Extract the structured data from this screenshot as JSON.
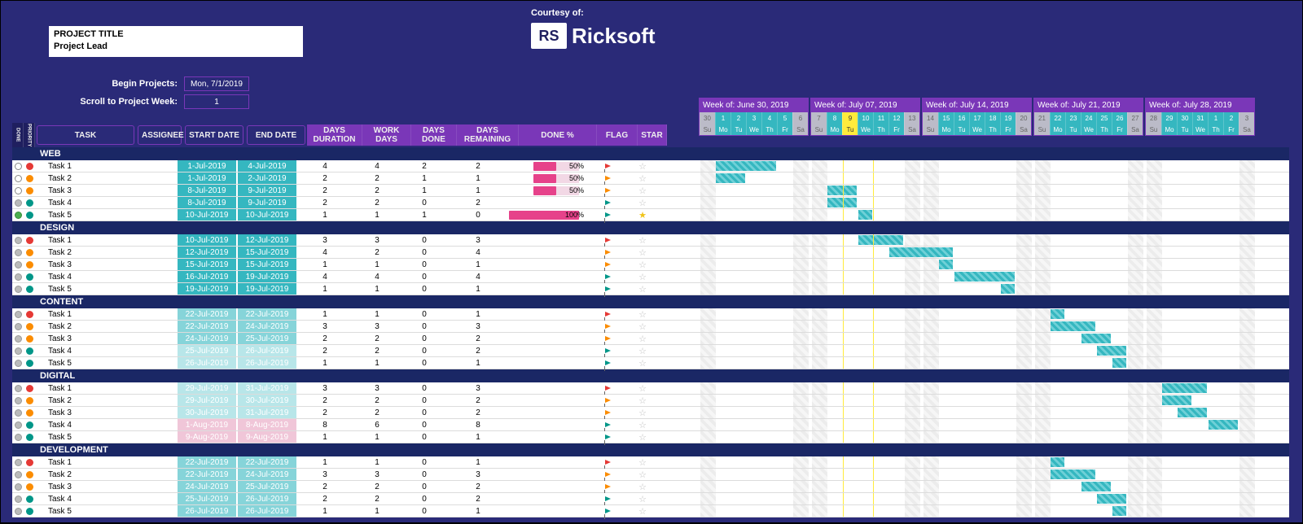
{
  "header": {
    "project_title_label": "PROJECT TITLE",
    "project_lead_label": "Project Lead",
    "courtesy": "Courtesy of:",
    "logo_text": "Ricksoft",
    "logo_badge": "RS",
    "begin_label": "Begin Projects:",
    "begin_value": "Mon, 7/1/2019",
    "scroll_label": "Scroll to Project Week:",
    "scroll_value": "1"
  },
  "columns": {
    "done": "DONE",
    "priority": "PRIORITY",
    "task": "TASK",
    "assignee": "ASSIGNEE",
    "start": "START DATE",
    "end": "END DATE",
    "duration": "DAYS DURATION",
    "work": "WORK DAYS",
    "days_done": "DAYS DONE",
    "days_remaining": "DAYS REMAINING",
    "done_pct": "DONE %",
    "flag": "FLAG",
    "star": "STAR"
  },
  "weeks": [
    {
      "label": "Week of: June 30, 2019",
      "days": [
        {
          "n": "30",
          "d": "Su",
          "t": "g"
        },
        {
          "n": "1",
          "d": "Mo",
          "t": "t"
        },
        {
          "n": "2",
          "d": "Tu",
          "t": "t"
        },
        {
          "n": "3",
          "d": "We",
          "t": "t"
        },
        {
          "n": "4",
          "d": "Th",
          "t": "t"
        },
        {
          "n": "5",
          "d": "Fr",
          "t": "t"
        },
        {
          "n": "6",
          "d": "Sa",
          "t": "g"
        }
      ]
    },
    {
      "label": "Week of: July 07, 2019",
      "days": [
        {
          "n": "7",
          "d": "Su",
          "t": "g"
        },
        {
          "n": "8",
          "d": "Mo",
          "t": "t"
        },
        {
          "n": "9",
          "d": "Tu",
          "t": "h"
        },
        {
          "n": "10",
          "d": "We",
          "t": "t"
        },
        {
          "n": "11",
          "d": "Th",
          "t": "t"
        },
        {
          "n": "12",
          "d": "Fr",
          "t": "t"
        },
        {
          "n": "13",
          "d": "Sa",
          "t": "g"
        }
      ]
    },
    {
      "label": "Week of: July 14, 2019",
      "days": [
        {
          "n": "14",
          "d": "Su",
          "t": "g"
        },
        {
          "n": "15",
          "d": "Mo",
          "t": "t"
        },
        {
          "n": "16",
          "d": "Tu",
          "t": "t"
        },
        {
          "n": "17",
          "d": "We",
          "t": "t"
        },
        {
          "n": "18",
          "d": "Th",
          "t": "t"
        },
        {
          "n": "19",
          "d": "Fr",
          "t": "t"
        },
        {
          "n": "20",
          "d": "Sa",
          "t": "g"
        }
      ]
    },
    {
      "label": "Week of: July 21, 2019",
      "days": [
        {
          "n": "21",
          "d": "Su",
          "t": "g"
        },
        {
          "n": "22",
          "d": "Mo",
          "t": "t"
        },
        {
          "n": "23",
          "d": "Tu",
          "t": "t"
        },
        {
          "n": "24",
          "d": "We",
          "t": "t"
        },
        {
          "n": "25",
          "d": "Th",
          "t": "t"
        },
        {
          "n": "26",
          "d": "Fr",
          "t": "t"
        },
        {
          "n": "27",
          "d": "Sa",
          "t": "g"
        }
      ]
    },
    {
      "label": "Week of: July 28, 2019",
      "days": [
        {
          "n": "28",
          "d": "Su",
          "t": "g"
        },
        {
          "n": "29",
          "d": "Mo",
          "t": "t"
        },
        {
          "n": "30",
          "d": "Tu",
          "t": "t"
        },
        {
          "n": "31",
          "d": "We",
          "t": "t"
        },
        {
          "n": "1",
          "d": "Th",
          "t": "t"
        },
        {
          "n": "2",
          "d": "Fr",
          "t": "t"
        },
        {
          "n": "3",
          "d": "Sa",
          "t": "g"
        }
      ]
    }
  ],
  "weekend_cols": [
    0,
    6,
    7,
    13,
    14,
    20,
    21,
    27,
    28,
    34
  ],
  "today_col_start": 9,
  "today_col_end": 10,
  "groups": [
    {
      "name": "WEB",
      "rows": [
        {
          "done": "open",
          "pri": "red",
          "task": "Task 1",
          "start": "1-Jul-2019",
          "end": "4-Jul-2019",
          "dur": 4,
          "wrk": 4,
          "dd": 2,
          "dr": 2,
          "pct": 50,
          "flag": "red",
          "star": "open",
          "bar": [
            1,
            4
          ],
          "fade": 0
        },
        {
          "done": "open",
          "pri": "orange",
          "task": "Task 2",
          "start": "1-Jul-2019",
          "end": "2-Jul-2019",
          "dur": 2,
          "wrk": 2,
          "dd": 1,
          "dr": 1,
          "pct": 50,
          "flag": "orange",
          "star": "open",
          "bar": [
            1,
            2
          ],
          "fade": 0
        },
        {
          "done": "open",
          "pri": "orange",
          "task": "Task 3",
          "start": "8-Jul-2019",
          "end": "9-Jul-2019",
          "dur": 2,
          "wrk": 2,
          "dd": 1,
          "dr": 1,
          "pct": 50,
          "flag": "orange",
          "star": "open",
          "bar": [
            8,
            9
          ],
          "fade": 0
        },
        {
          "done": "grey",
          "pri": "teal",
          "task": "Task 4",
          "start": "8-Jul-2019",
          "end": "9-Jul-2019",
          "dur": 2,
          "wrk": 2,
          "dd": 0,
          "dr": 2,
          "pct": 0,
          "flag": "teal",
          "star": "open",
          "bar": [
            8,
            9
          ],
          "fade": 0
        },
        {
          "done": "check",
          "pri": "teal",
          "task": "Task 5",
          "start": "10-Jul-2019",
          "end": "10-Jul-2019",
          "dur": 1,
          "wrk": 1,
          "dd": 1,
          "dr": 0,
          "pct": 100,
          "flag": "teal",
          "star": "gold",
          "bar": [
            10,
            10
          ],
          "fade": 0
        }
      ]
    },
    {
      "name": "DESIGN",
      "rows": [
        {
          "done": "grey",
          "pri": "red",
          "task": "Task 1",
          "start": "10-Jul-2019",
          "end": "12-Jul-2019",
          "dur": 3,
          "wrk": 3,
          "dd": 0,
          "dr": 3,
          "pct": 0,
          "flag": "red",
          "star": "open",
          "bar": [
            10,
            12
          ],
          "fade": 0
        },
        {
          "done": "grey",
          "pri": "orange",
          "task": "Task 2",
          "start": "12-Jul-2019",
          "end": "15-Jul-2019",
          "dur": 4,
          "wrk": 2,
          "dd": 0,
          "dr": 4,
          "pct": 0,
          "flag": "orange",
          "star": "open",
          "bar": [
            12,
            15
          ],
          "fade": 0
        },
        {
          "done": "grey",
          "pri": "orange",
          "task": "Task 3",
          "start": "15-Jul-2019",
          "end": "15-Jul-2019",
          "dur": 1,
          "wrk": 1,
          "dd": 0,
          "dr": 1,
          "pct": 0,
          "flag": "orange",
          "star": "open",
          "bar": [
            15,
            15
          ],
          "fade": 0
        },
        {
          "done": "grey",
          "pri": "teal",
          "task": "Task 4",
          "start": "16-Jul-2019",
          "end": "19-Jul-2019",
          "dur": 4,
          "wrk": 4,
          "dd": 0,
          "dr": 4,
          "pct": 0,
          "flag": "teal",
          "star": "open",
          "bar": [
            16,
            19
          ],
          "fade": 0
        },
        {
          "done": "grey",
          "pri": "teal",
          "task": "Task 5",
          "start": "19-Jul-2019",
          "end": "19-Jul-2019",
          "dur": 1,
          "wrk": 1,
          "dd": 0,
          "dr": 1,
          "pct": 0,
          "flag": "teal",
          "star": "open",
          "bar": [
            19,
            19
          ],
          "fade": 0
        }
      ]
    },
    {
      "name": "CONTENT",
      "rows": [
        {
          "done": "grey",
          "pri": "red",
          "task": "Task 1",
          "start": "22-Jul-2019",
          "end": "22-Jul-2019",
          "dur": 1,
          "wrk": 1,
          "dd": 0,
          "dr": 1,
          "pct": 0,
          "flag": "red",
          "star": "open",
          "bar": [
            22,
            22
          ],
          "fade": 1
        },
        {
          "done": "grey",
          "pri": "orange",
          "task": "Task 2",
          "start": "22-Jul-2019",
          "end": "24-Jul-2019",
          "dur": 3,
          "wrk": 3,
          "dd": 0,
          "dr": 3,
          "pct": 0,
          "flag": "orange",
          "star": "open",
          "bar": [
            22,
            24
          ],
          "fade": 1
        },
        {
          "done": "grey",
          "pri": "orange",
          "task": "Task 3",
          "start": "24-Jul-2019",
          "end": "25-Jul-2019",
          "dur": 2,
          "wrk": 2,
          "dd": 0,
          "dr": 2,
          "pct": 0,
          "flag": "orange",
          "star": "open",
          "bar": [
            24,
            25
          ],
          "fade": 1
        },
        {
          "done": "grey",
          "pri": "teal",
          "task": "Task 4",
          "start": "25-Jul-2019",
          "end": "26-Jul-2019",
          "dur": 2,
          "wrk": 2,
          "dd": 0,
          "dr": 2,
          "pct": 0,
          "flag": "teal",
          "star": "open",
          "bar": [
            25,
            26
          ],
          "fade": 2
        },
        {
          "done": "grey",
          "pri": "teal",
          "task": "Task 5",
          "start": "26-Jul-2019",
          "end": "26-Jul-2019",
          "dur": 1,
          "wrk": 1,
          "dd": 0,
          "dr": 1,
          "pct": 0,
          "flag": "teal",
          "star": "open",
          "bar": [
            26,
            26
          ],
          "fade": 2
        }
      ]
    },
    {
      "name": "DIGITAL",
      "rows": [
        {
          "done": "grey",
          "pri": "red",
          "task": "Task 1",
          "start": "29-Jul-2019",
          "end": "31-Jul-2019",
          "dur": 3,
          "wrk": 3,
          "dd": 0,
          "dr": 3,
          "pct": 0,
          "flag": "red",
          "star": "open",
          "bar": [
            29,
            31
          ],
          "fade": 2
        },
        {
          "done": "grey",
          "pri": "orange",
          "task": "Task 2",
          "start": "29-Jul-2019",
          "end": "30-Jul-2019",
          "dur": 2,
          "wrk": 2,
          "dd": 0,
          "dr": 2,
          "pct": 0,
          "flag": "orange",
          "star": "open",
          "bar": [
            29,
            30
          ],
          "fade": 2
        },
        {
          "done": "grey",
          "pri": "orange",
          "task": "Task 3",
          "start": "30-Jul-2019",
          "end": "31-Jul-2019",
          "dur": 2,
          "wrk": 2,
          "dd": 0,
          "dr": 2,
          "pct": 0,
          "flag": "orange",
          "star": "open",
          "bar": [
            30,
            31
          ],
          "fade": 2
        },
        {
          "done": "grey",
          "pri": "teal",
          "task": "Task 4",
          "start": "1-Aug-2019",
          "end": "8-Aug-2019",
          "dur": 8,
          "wrk": 6,
          "dd": 0,
          "dr": 8,
          "pct": 0,
          "flag": "teal",
          "star": "open",
          "bar": [
            32,
            33
          ],
          "fade": 3
        },
        {
          "done": "grey",
          "pri": "teal",
          "task": "Task 5",
          "start": "9-Aug-2019",
          "end": "9-Aug-2019",
          "dur": 1,
          "wrk": 1,
          "dd": 0,
          "dr": 1,
          "pct": 0,
          "flag": "teal",
          "star": "open",
          "bar": [
            -1,
            -1
          ],
          "fade": 3
        }
      ]
    },
    {
      "name": "DEVELOPMENT",
      "rows": [
        {
          "done": "grey",
          "pri": "red",
          "task": "Task 1",
          "start": "22-Jul-2019",
          "end": "22-Jul-2019",
          "dur": 1,
          "wrk": 1,
          "dd": 0,
          "dr": 1,
          "pct": 0,
          "flag": "red",
          "star": "open",
          "bar": [
            22,
            22
          ],
          "fade": 1
        },
        {
          "done": "grey",
          "pri": "orange",
          "task": "Task 2",
          "start": "22-Jul-2019",
          "end": "24-Jul-2019",
          "dur": 3,
          "wrk": 3,
          "dd": 0,
          "dr": 3,
          "pct": 0,
          "flag": "orange",
          "star": "open",
          "bar": [
            22,
            24
          ],
          "fade": 1
        },
        {
          "done": "grey",
          "pri": "orange",
          "task": "Task 3",
          "start": "24-Jul-2019",
          "end": "25-Jul-2019",
          "dur": 2,
          "wrk": 2,
          "dd": 0,
          "dr": 2,
          "pct": 0,
          "flag": "orange",
          "star": "open",
          "bar": [
            24,
            25
          ],
          "fade": 1
        },
        {
          "done": "grey",
          "pri": "teal",
          "task": "Task 4",
          "start": "25-Jul-2019",
          "end": "26-Jul-2019",
          "dur": 2,
          "wrk": 2,
          "dd": 0,
          "dr": 2,
          "pct": 0,
          "flag": "teal",
          "star": "open",
          "bar": [
            25,
            26
          ],
          "fade": 1
        },
        {
          "done": "grey",
          "pri": "teal",
          "task": "Task 5",
          "start": "26-Jul-2019",
          "end": "26-Jul-2019",
          "dur": 1,
          "wrk": 1,
          "dd": 0,
          "dr": 1,
          "pct": 0,
          "flag": "teal",
          "star": "open",
          "bar": [
            26,
            26
          ],
          "fade": 1
        }
      ]
    }
  ],
  "chart_data": {
    "type": "gantt",
    "start_date": "2019-06-30",
    "end_date": "2019-08-03",
    "highlight_date": "2019-07-09",
    "groups": [
      "WEB",
      "DESIGN",
      "CONTENT",
      "DIGITAL",
      "DEVELOPMENT"
    ],
    "tasks": [
      {
        "group": "WEB",
        "name": "Task 1",
        "start": "2019-07-01",
        "end": "2019-07-04",
        "pct_done": 50
      },
      {
        "group": "WEB",
        "name": "Task 2",
        "start": "2019-07-01",
        "end": "2019-07-02",
        "pct_done": 50
      },
      {
        "group": "WEB",
        "name": "Task 3",
        "start": "2019-07-08",
        "end": "2019-07-09",
        "pct_done": 50
      },
      {
        "group": "WEB",
        "name": "Task 4",
        "start": "2019-07-08",
        "end": "2019-07-09",
        "pct_done": 0
      },
      {
        "group": "WEB",
        "name": "Task 5",
        "start": "2019-07-10",
        "end": "2019-07-10",
        "pct_done": 100
      },
      {
        "group": "DESIGN",
        "name": "Task 1",
        "start": "2019-07-10",
        "end": "2019-07-12",
        "pct_done": 0
      },
      {
        "group": "DESIGN",
        "name": "Task 2",
        "start": "2019-07-12",
        "end": "2019-07-15",
        "pct_done": 0
      },
      {
        "group": "DESIGN",
        "name": "Task 3",
        "start": "2019-07-15",
        "end": "2019-07-15",
        "pct_done": 0
      },
      {
        "group": "DESIGN",
        "name": "Task 4",
        "start": "2019-07-16",
        "end": "2019-07-19",
        "pct_done": 0
      },
      {
        "group": "DESIGN",
        "name": "Task 5",
        "start": "2019-07-19",
        "end": "2019-07-19",
        "pct_done": 0
      },
      {
        "group": "CONTENT",
        "name": "Task 1",
        "start": "2019-07-22",
        "end": "2019-07-22",
        "pct_done": 0
      },
      {
        "group": "CONTENT",
        "name": "Task 2",
        "start": "2019-07-22",
        "end": "2019-07-24",
        "pct_done": 0
      },
      {
        "group": "CONTENT",
        "name": "Task 3",
        "start": "2019-07-24",
        "end": "2019-07-25",
        "pct_done": 0
      },
      {
        "group": "CONTENT",
        "name": "Task 4",
        "start": "2019-07-25",
        "end": "2019-07-26",
        "pct_done": 0
      },
      {
        "group": "CONTENT",
        "name": "Task 5",
        "start": "2019-07-26",
        "end": "2019-07-26",
        "pct_done": 0
      },
      {
        "group": "DIGITAL",
        "name": "Task 1",
        "start": "2019-07-29",
        "end": "2019-07-31",
        "pct_done": 0
      },
      {
        "group": "DIGITAL",
        "name": "Task 2",
        "start": "2019-07-29",
        "end": "2019-07-30",
        "pct_done": 0
      },
      {
        "group": "DIGITAL",
        "name": "Task 3",
        "start": "2019-07-30",
        "end": "2019-07-31",
        "pct_done": 0
      },
      {
        "group": "DIGITAL",
        "name": "Task 4",
        "start": "2019-08-01",
        "end": "2019-08-08",
        "pct_done": 0
      },
      {
        "group": "DIGITAL",
        "name": "Task 5",
        "start": "2019-08-09",
        "end": "2019-08-09",
        "pct_done": 0
      },
      {
        "group": "DEVELOPMENT",
        "name": "Task 1",
        "start": "2019-07-22",
        "end": "2019-07-22",
        "pct_done": 0
      },
      {
        "group": "DEVELOPMENT",
        "name": "Task 2",
        "start": "2019-07-22",
        "end": "2019-07-24",
        "pct_done": 0
      },
      {
        "group": "DEVELOPMENT",
        "name": "Task 3",
        "start": "2019-07-24",
        "end": "2019-07-25",
        "pct_done": 0
      },
      {
        "group": "DEVELOPMENT",
        "name": "Task 4",
        "start": "2019-07-25",
        "end": "2019-07-26",
        "pct_done": 0
      },
      {
        "group": "DEVELOPMENT",
        "name": "Task 5",
        "start": "2019-07-26",
        "end": "2019-07-26",
        "pct_done": 0
      }
    ]
  }
}
